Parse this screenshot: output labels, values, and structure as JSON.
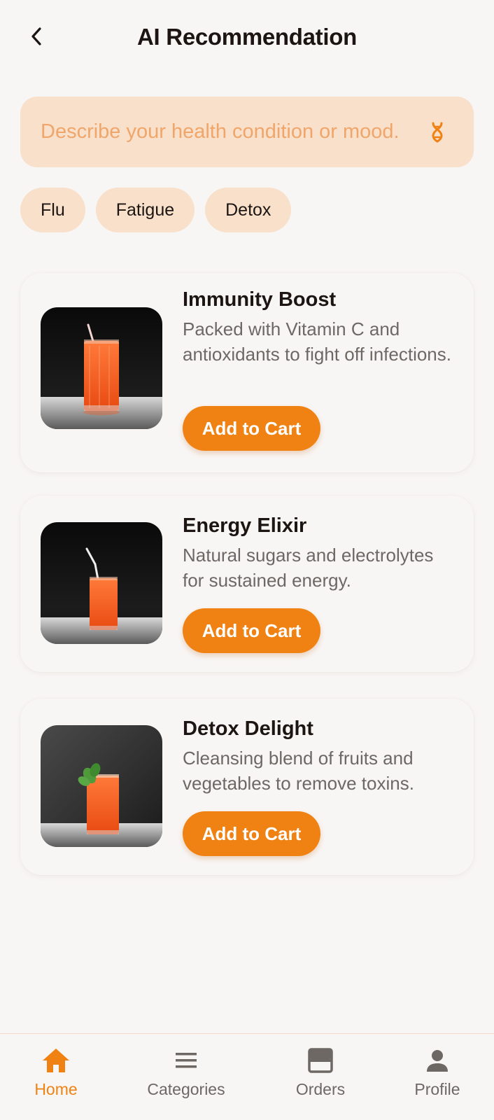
{
  "header": {
    "title": "AI Recommendation",
    "back_icon": "chevron-left-icon"
  },
  "search": {
    "placeholder": "Describe your health condition or mood.",
    "value": "",
    "icon": "dna-icon"
  },
  "chips": [
    {
      "label": "Flu"
    },
    {
      "label": "Fatigue"
    },
    {
      "label": "Detox"
    }
  ],
  "recommendations": [
    {
      "title": "Immunity Boost",
      "description": "Packed with Vitamin C and antioxidants to fight off infections.",
      "button_label": "Add to Cart",
      "image": "juice-glass-with-straw"
    },
    {
      "title": "Energy Elixir",
      "description": "Natural sugars and electrolytes for sustained energy.",
      "button_label": "Add to Cart",
      "image": "juice-glass-with-straw"
    },
    {
      "title": "Detox Delight",
      "description": "Cleansing blend of fruits and vegetables to remove toxins.",
      "button_label": "Add to Cart",
      "image": "juice-glass-with-mint"
    }
  ],
  "bottom_nav": {
    "items": [
      {
        "label": "Home",
        "icon": "home-icon",
        "active": true
      },
      {
        "label": "Categories",
        "icon": "menu-icon",
        "active": false
      },
      {
        "label": "Orders",
        "icon": "orders-icon",
        "active": false
      },
      {
        "label": "Profile",
        "icon": "person-icon",
        "active": false
      }
    ]
  },
  "colors": {
    "accent": "#F08214",
    "background": "#F8F6F5",
    "soft_accent": "#F8E0CB",
    "placeholder": "#F0A66A",
    "text": "#1C1512",
    "muted_text": "#6E6865"
  }
}
